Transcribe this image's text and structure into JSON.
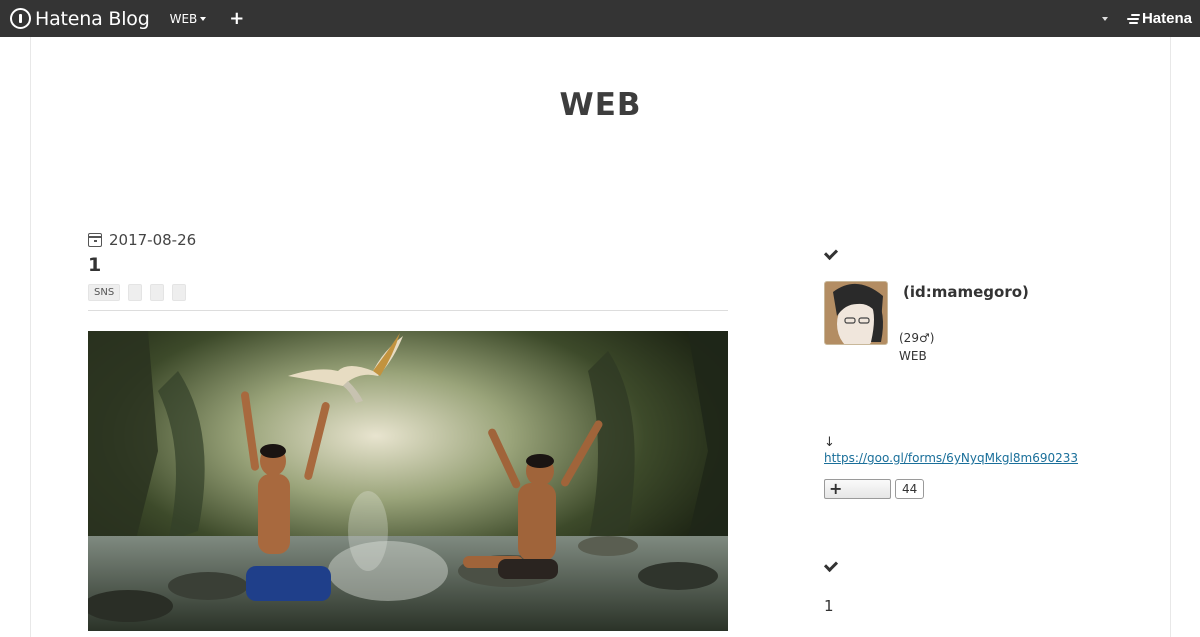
{
  "globalbar": {
    "brand": "Hatena Blog",
    "blog_switcher": "WEB",
    "add_label": "+",
    "hatena_logo": "Hatena",
    "colors": {
      "background": "#343434",
      "text": "#ffffff"
    }
  },
  "blog": {
    "title": "WEB"
  },
  "entry": {
    "date": "2017-08-26",
    "title": "1",
    "categories": [
      "SNS",
      "",
      "",
      ""
    ],
    "image_icon": "entry-photo"
  },
  "sidebar": {
    "profile_module": {
      "heading_icon": "check-icon",
      "id": "(id:mamegoro)",
      "age": "(29♂)",
      "desc": "WEB",
      "arrow": "↓",
      "link": "https://goo.gl/forms/6yNyqMkgl8m690233",
      "subscribe_count": "44"
    },
    "second_module": {
      "heading_icon": "check-icon",
      "body": "1"
    }
  }
}
